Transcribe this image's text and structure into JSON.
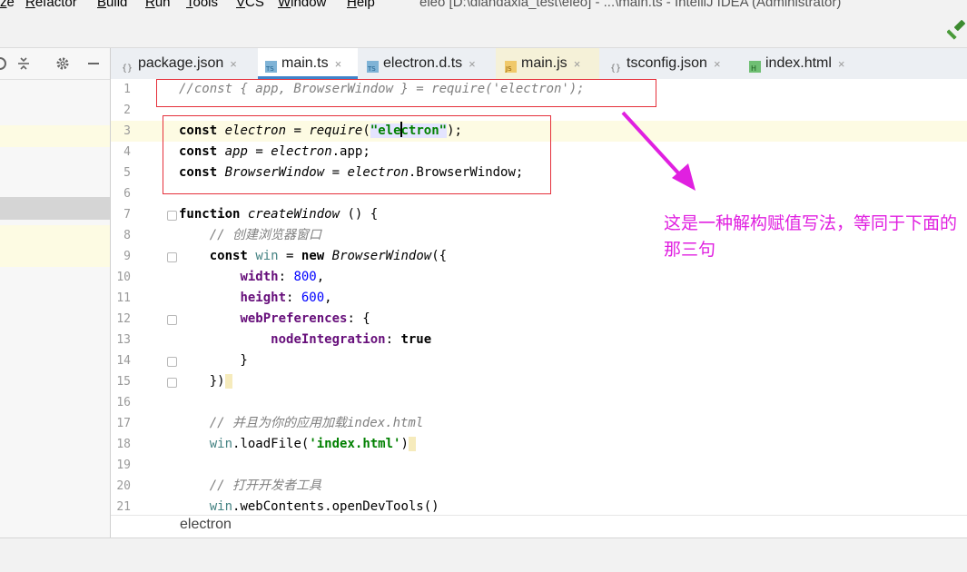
{
  "menu": {
    "items": [
      "ze",
      "Refactor",
      "Build",
      "Run",
      "Tools",
      "VCS",
      "Window",
      "Help"
    ],
    "window_title": "eleo [D:\\diandaxia_test\\eleo] - ...\\main.ts - IntelliJ IDEA (Administrator)"
  },
  "toolbar": {
    "build_icon": "hammer-icon"
  },
  "tabs": [
    {
      "label": "package.json",
      "icon": "json-file-icon",
      "close": "×"
    },
    {
      "label": "main.ts",
      "icon": "ts-file-icon",
      "close": "×"
    },
    {
      "label": "electron.d.ts",
      "icon": "ts-file-icon",
      "close": "×"
    },
    {
      "label": "main.js",
      "icon": "js-file-icon",
      "close": "×"
    },
    {
      "label": "tsconfig.json",
      "icon": "json-file-icon",
      "close": "×"
    },
    {
      "label": "index.html",
      "icon": "html-file-icon",
      "close": "×"
    }
  ],
  "editor": {
    "line_numbers": [
      "1",
      "2",
      "3",
      "4",
      "5",
      "6",
      "7",
      "8",
      "9",
      "10",
      "11",
      "12",
      "13",
      "14",
      "15",
      "16",
      "17",
      "18",
      "19",
      "20",
      "21"
    ],
    "current_line": 3
  },
  "annotation": {
    "text": "这是一种解构赋值写法，等同于下面的那三句"
  },
  "breadcrumb": {
    "text": "electron"
  },
  "colors": {
    "annotation": "#e020e0",
    "highlight_box": "#e5303b",
    "active_tab_underline": "#4083c9",
    "current_line": "#fdfbe3"
  }
}
